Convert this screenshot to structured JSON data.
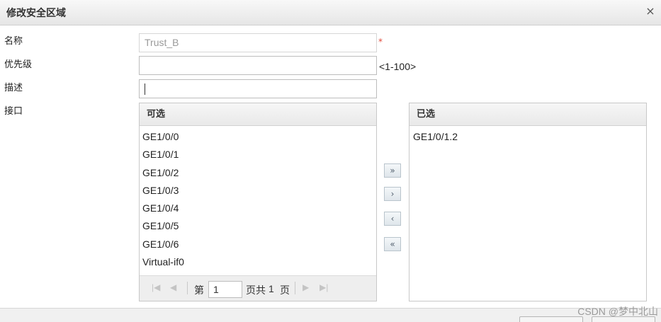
{
  "dialog": {
    "title": "修改安全区域",
    "close_icon": "close-icon",
    "close_glyph": "×"
  },
  "form": {
    "name_label": "名称",
    "name_value": "Trust_B",
    "required_mark": "*",
    "priority_label": "优先级",
    "priority_value": "",
    "priority_range": "<1-100>",
    "description_label": "描述",
    "description_value": "",
    "interface_label": "接口"
  },
  "available": {
    "header": "可选",
    "items": [
      "GE1/0/0",
      "GE1/0/1",
      "GE1/0/2",
      "GE1/0/3",
      "GE1/0/4",
      "GE1/0/5",
      "GE1/0/6",
      "Virtual-if0"
    ]
  },
  "selected": {
    "header": "已选",
    "items": [
      "GE1/0/1.2"
    ]
  },
  "pager": {
    "page_prefix": "第",
    "current_page": "1",
    "page_suffix": "页共",
    "total_pages": "1",
    "total_suffix": "页"
  },
  "move_buttons": {
    "add_all": "»",
    "add": "›",
    "remove": "‹",
    "remove_all": "«"
  },
  "watermark": "CSDN @梦中北山"
}
